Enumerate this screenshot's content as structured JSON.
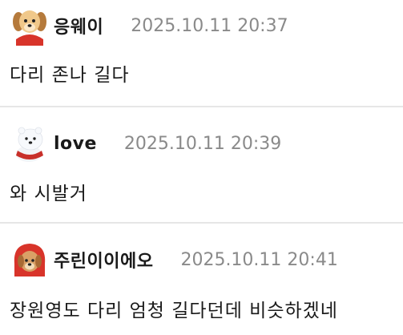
{
  "comments": [
    {
      "avatar_icon": "puppy-icon",
      "nickname": "응웨이",
      "timestamp": "2025.10.11 20:37",
      "text": "다리 존나 길다"
    },
    {
      "avatar_icon": "polar-bear-cub-icon",
      "nickname": "love",
      "timestamp": "2025.10.11 20:39",
      "text": "와 시발거"
    },
    {
      "avatar_icon": "puppy-red-hood-icon",
      "nickname": "주린이이에오",
      "timestamp": "2025.10.11 20:41",
      "text": "장원영도 다리 엄청 길다던데 비슷하겠네"
    }
  ]
}
